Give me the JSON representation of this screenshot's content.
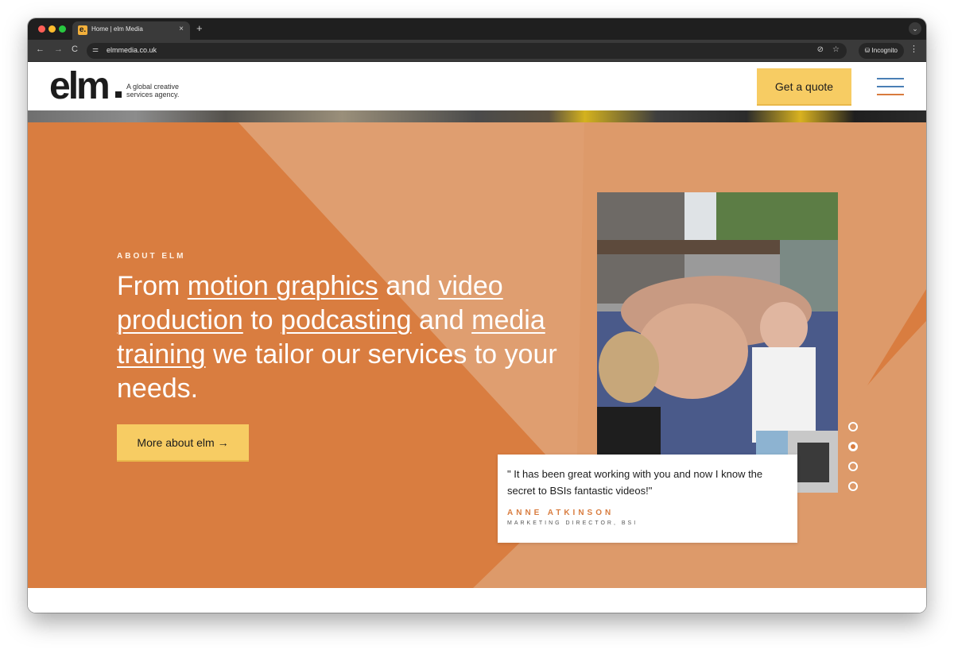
{
  "browser": {
    "tab_title": "Home | elm Media",
    "tab_favicon": "e.",
    "tab_close": "×",
    "new_tab": "+",
    "tab_search_icon": "⌄",
    "url": "elmmedia.co.uk",
    "incognito_label": "Incognito",
    "back_icon": "←",
    "forward_icon": "→",
    "reload_icon": "C",
    "site_info_icon": "⚌",
    "eye_icon": "⊘",
    "star_icon": "☆",
    "incognito_icon": "⛁",
    "menu_icon": "⋮"
  },
  "header": {
    "logo": "elm",
    "tagline": "A global creative services agency.",
    "quote_button": "Get a quote",
    "menu_icon": "hamburger-icon"
  },
  "hero": {
    "kicker": "ABOUT ELM",
    "headline": {
      "p1": "From ",
      "l1": "motion graphics",
      "p2": " and ",
      "l2": "video production",
      "p3": " to ",
      "l3": "podcasting",
      "p4": " and ",
      "l4": "media training",
      "p5": " we tailor our services to your needs."
    },
    "cta": "More about elm →",
    "testimonial": {
      "quote": "\" It has been great working with you and now I know the secret to BSIs fantastic videos!\"",
      "name": "ANNE ATKINSON",
      "role": "MARKETING DIRECTOR, BSI"
    },
    "slides": {
      "count": 4,
      "active": 2
    }
  },
  "colors": {
    "brand_orange": "#d97d40",
    "accent_yellow": "#f7cc63",
    "menu_blue": "#4a7fb5"
  }
}
